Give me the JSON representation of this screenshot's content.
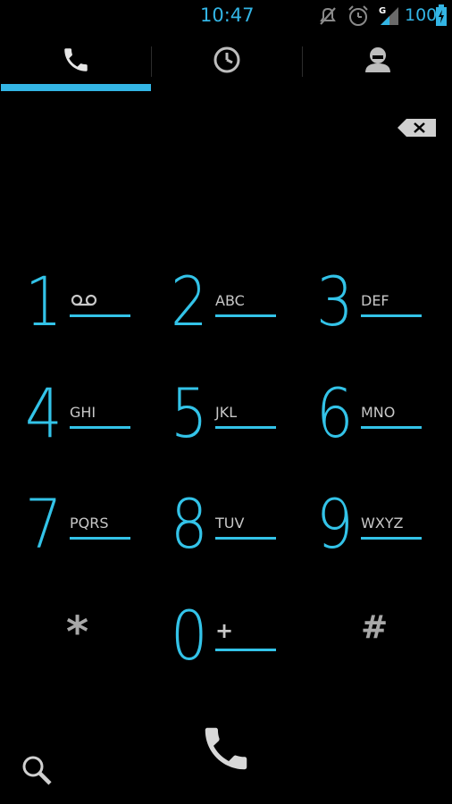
{
  "status_bar": {
    "time": "10:47",
    "network_type": "G",
    "battery_percent": "100",
    "icons": [
      "mute-icon",
      "alarm-icon",
      "signal-icon",
      "battery-charging-icon"
    ],
    "accent_color": "#33b5e5"
  },
  "tabs": [
    {
      "name": "phone",
      "icon": "phone-icon",
      "selected": true
    },
    {
      "name": "call-log",
      "icon": "clock-icon",
      "selected": false
    },
    {
      "name": "contacts",
      "icon": "contact-icon",
      "selected": false
    }
  ],
  "digits": {
    "value": ""
  },
  "dialpad": {
    "keys": [
      {
        "digit": "1",
        "letters": ""
      },
      {
        "digit": "2",
        "letters": "ABC"
      },
      {
        "digit": "3",
        "letters": "DEF"
      },
      {
        "digit": "4",
        "letters": "GHI"
      },
      {
        "digit": "5",
        "letters": "JKL"
      },
      {
        "digit": "6",
        "letters": "MNO"
      },
      {
        "digit": "7",
        "letters": "PQRS"
      },
      {
        "digit": "8",
        "letters": "TUV"
      },
      {
        "digit": "9",
        "letters": "WXYZ"
      },
      {
        "digit": "*",
        "letters": ""
      },
      {
        "digit": "0",
        "letters": "+"
      },
      {
        "digit": "#",
        "letters": ""
      }
    ],
    "digit_color": "#33c3e8"
  }
}
